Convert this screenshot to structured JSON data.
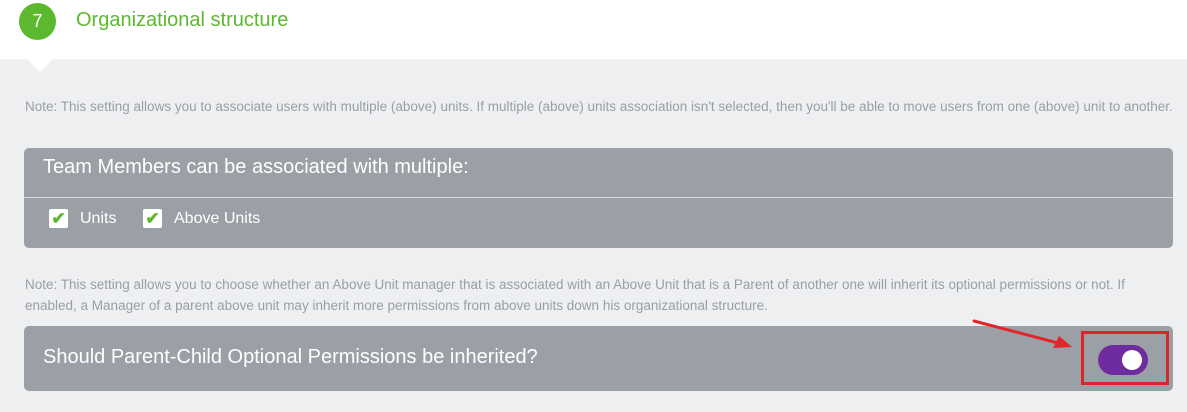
{
  "section": {
    "step_number": "7",
    "title": "Organizational structure"
  },
  "note_multiple": "Note: This setting allows you to associate users with multiple (above) units. If multiple (above) units association isn't selected, then you'll be able to move users from one (above) unit to another.",
  "association_panel": {
    "heading": "Team Members can be associated with multiple:",
    "options": [
      {
        "label": "Units",
        "checked": true
      },
      {
        "label": "Above Units",
        "checked": true
      }
    ]
  },
  "note_inherit": "Note: This setting allows you to choose whether an Above Unit manager that is associated with an Above Unit that is a Parent of another one will inherit its optional permissions or not. If enabled, a Manager of a parent above unit may inherit more permissions from above units down his organizational structure.",
  "inherit_panel": {
    "question": "Should Parent-Child Optional Permissions be inherited?",
    "toggle_on": true
  },
  "colors": {
    "accent_green": "#5cb82e",
    "panel_gray": "#9aa0a5",
    "toggle_purple": "#6f2c9e",
    "highlight_red": "#d9262c"
  },
  "icons": {
    "checkbox": "checkmark-icon",
    "annotation": "red-arrow-icon"
  }
}
